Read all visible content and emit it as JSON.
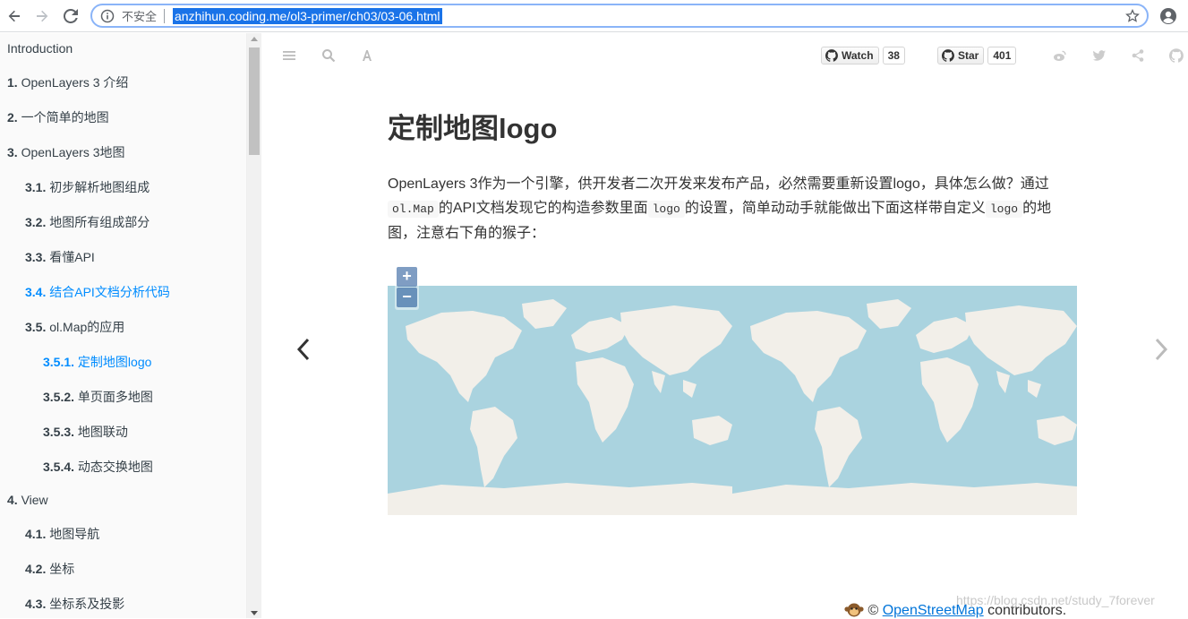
{
  "browser": {
    "insecure_label": "不安全",
    "url": "anzhihun.coding.me/ol3-primer/ch03/03-06.html"
  },
  "sidebar": {
    "items": [
      {
        "num": "",
        "label": "Introduction",
        "level": 0
      },
      {
        "num": "1.",
        "label": "OpenLayers 3 介绍",
        "level": 0
      },
      {
        "num": "2.",
        "label": "一个简单的地图",
        "level": 0
      },
      {
        "num": "3.",
        "label": "OpenLayers 3地图",
        "level": 0
      },
      {
        "num": "3.1.",
        "label": "初步解析地图组成",
        "level": 1
      },
      {
        "num": "3.2.",
        "label": "地图所有组成部分",
        "level": 1
      },
      {
        "num": "3.3.",
        "label": "看懂API",
        "level": 1
      },
      {
        "num": "3.4.",
        "label": "结合API文档分析代码",
        "level": 1
      },
      {
        "num": "3.5.",
        "label": "ol.Map的应用",
        "level": 1
      },
      {
        "num": "3.5.1.",
        "label": "定制地图logo",
        "level": 2
      },
      {
        "num": "3.5.2.",
        "label": "单页面多地图",
        "level": 2
      },
      {
        "num": "3.5.3.",
        "label": "地图联动",
        "level": 2
      },
      {
        "num": "3.5.4.",
        "label": "动态交换地图",
        "level": 2
      },
      {
        "num": "4.",
        "label": "View",
        "level": 0
      },
      {
        "num": "4.1.",
        "label": "地图导航",
        "level": 1
      },
      {
        "num": "4.2.",
        "label": "坐标",
        "level": 1
      },
      {
        "num": "4.3.",
        "label": "坐标系及投影",
        "level": 1
      }
    ]
  },
  "header": {
    "watch_label": "Watch",
    "watch_count": "38",
    "star_label": "Star",
    "star_count": "401"
  },
  "content": {
    "title": "定制地图logo",
    "para_part1": "OpenLayers 3作为一个引擎，供开发者二次开发来发布产品，必然需要重新设置logo，具体怎么做？通过",
    "code1": "ol.Map",
    "para_part2": "的API文档发现它的构造参数里面",
    "code2": "logo",
    "para_part3": "的设置，简单动动手就能做出下面这样带自定义",
    "code3": "logo",
    "para_part4": "的地图，注意右下角的猴子："
  },
  "map": {
    "zoom_in": "+",
    "zoom_out": "−",
    "attribution_prefix": "©",
    "attribution_link": "OpenStreetMap",
    "attribution_suffix": " contributors.",
    "ocean_color": "#aad3df",
    "land_color": "#f2efe9"
  },
  "watermark": "https://blog.csdn.net/study_7forever"
}
